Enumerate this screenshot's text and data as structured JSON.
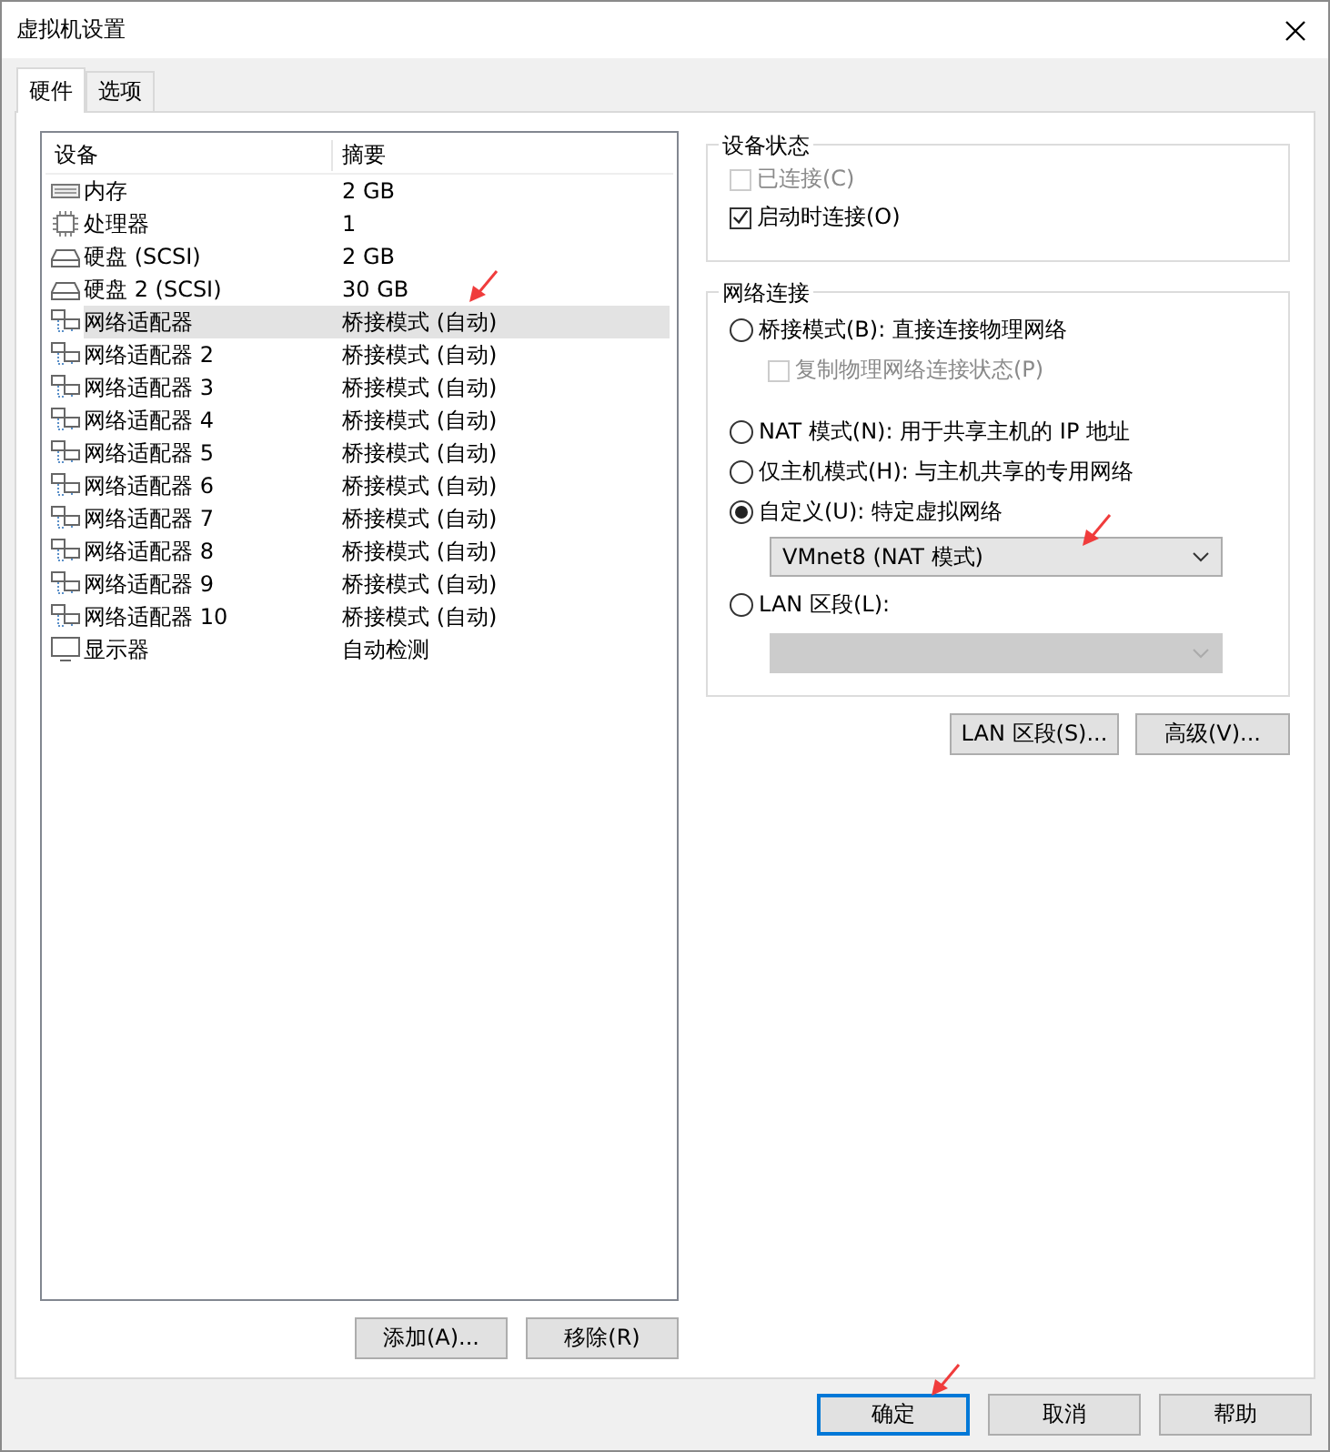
{
  "window": {
    "title": "虚拟机设置"
  },
  "tabs": [
    {
      "label": "硬件",
      "selected": true
    },
    {
      "label": "选项",
      "selected": false
    }
  ],
  "devices": {
    "columns": [
      "设备",
      "摘要"
    ],
    "rows": [
      {
        "kind": "memory",
        "name": "内存",
        "summary": "2 GB",
        "selected": false
      },
      {
        "kind": "cpu",
        "name": "处理器",
        "summary": "1",
        "selected": false
      },
      {
        "kind": "disk",
        "name": "硬盘 (SCSI)",
        "summary": "2 GB",
        "selected": false
      },
      {
        "kind": "disk",
        "name": "硬盘 2 (SCSI)",
        "summary": "30 GB",
        "selected": false
      },
      {
        "kind": "network",
        "name": "网络适配器",
        "summary": "桥接模式 (自动)",
        "selected": true
      },
      {
        "kind": "network",
        "name": "网络适配器 2",
        "summary": "桥接模式 (自动)",
        "selected": false
      },
      {
        "kind": "network",
        "name": "网络适配器 3",
        "summary": "桥接模式 (自动)",
        "selected": false
      },
      {
        "kind": "network",
        "name": "网络适配器 4",
        "summary": "桥接模式 (自动)",
        "selected": false
      },
      {
        "kind": "network",
        "name": "网络适配器 5",
        "summary": "桥接模式 (自动)",
        "selected": false
      },
      {
        "kind": "network",
        "name": "网络适配器 6",
        "summary": "桥接模式 (自动)",
        "selected": false
      },
      {
        "kind": "network",
        "name": "网络适配器 7",
        "summary": "桥接模式 (自动)",
        "selected": false
      },
      {
        "kind": "network",
        "name": "网络适配器 8",
        "summary": "桥接模式 (自动)",
        "selected": false
      },
      {
        "kind": "network",
        "name": "网络适配器 9",
        "summary": "桥接模式 (自动)",
        "selected": false
      },
      {
        "kind": "network",
        "name": "网络适配器 10",
        "summary": "桥接模式 (自动)",
        "selected": false
      },
      {
        "kind": "display",
        "name": "显示器",
        "summary": "自动检测",
        "selected": false
      }
    ],
    "buttons": [
      "添加(A)...",
      "移除(R)"
    ]
  },
  "device_status": {
    "title": "设备状态",
    "items": [
      {
        "label": "已连接(C)",
        "checked": false,
        "disabled": true
      },
      {
        "label": "启动时连接(O)",
        "checked": true,
        "disabled": false
      }
    ]
  },
  "network_connection": {
    "title": "网络连接",
    "items": [
      {
        "kind": "radio",
        "label": "桥接模式(B): 直接连接物理网络",
        "selected": false
      },
      {
        "kind": "checkbox",
        "label": "复制物理网络连接状态(P)",
        "checked": false,
        "disabled": true
      },
      {
        "kind": "radio",
        "label": "NAT 模式(N): 用于共享主机的 IP 地址",
        "selected": false
      },
      {
        "kind": "radio",
        "label": "仅主机模式(H): 与主机共享的专用网络",
        "selected": false
      },
      {
        "kind": "radio",
        "label": "自定义(U): 特定虚拟网络",
        "selected": true
      },
      {
        "kind": "select",
        "value": "VMnet8 (NAT 模式)",
        "disabled": false
      },
      {
        "kind": "radio",
        "label": "LAN 区段(L):",
        "selected": false
      },
      {
        "kind": "select",
        "disabled": true
      }
    ]
  },
  "side_buttons": [
    "LAN 区段(S)...",
    "高级(V)..."
  ],
  "dialog_buttons": [
    {
      "label": "确定",
      "default": true
    },
    {
      "label": "取消",
      "default": false
    },
    {
      "label": "帮助",
      "default": false
    }
  ]
}
